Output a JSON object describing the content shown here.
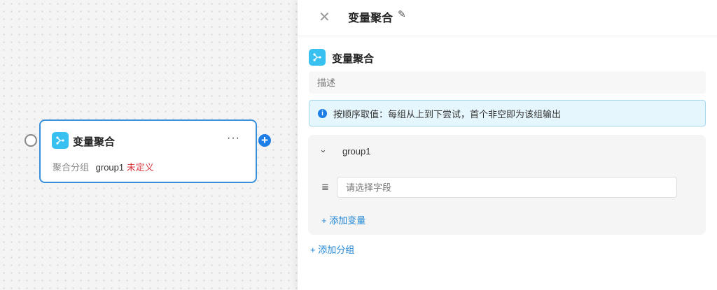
{
  "node": {
    "title": "变量聚合",
    "menu": "···",
    "row_label": "聚合分组",
    "group": "group1",
    "status": "未定义",
    "status_color": "#d9363e"
  },
  "panel": {
    "title": "变量聚合",
    "section_title": "变量聚合",
    "description_placeholder": "描述",
    "info": "按顺序取值：每组从上到下尝试，首个非空即为该组输出",
    "groups": [
      {
        "name": "group1",
        "field_placeholder": "请选择字段",
        "add_variable": "+ 添加变量"
      }
    ],
    "add_group": "+ 添加分组"
  },
  "colors": {
    "accent": "#1f86d6",
    "icon_bg": "#38c0f0",
    "info_bg": "#e6f6fd"
  }
}
